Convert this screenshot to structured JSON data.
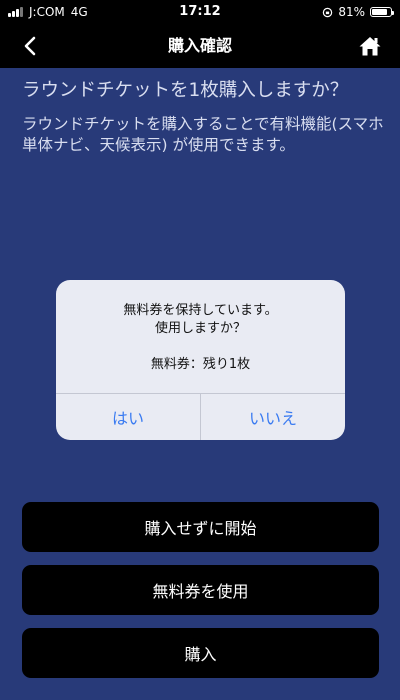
{
  "status_bar": {
    "carrier": "J:COM",
    "network": "4G",
    "time": "17:12",
    "battery": "81%",
    "battery_level": 0.81
  },
  "nav": {
    "title": "購入確認",
    "back_icon": "chevron-left-icon",
    "home_icon": "home-icon"
  },
  "content": {
    "question": "ラウンドチケットを1枚購入しますか？",
    "description": "ラウンドチケットを購入することで有料機能(スマホ単体ナビ、天候表示) が使用できます。"
  },
  "dialog": {
    "message_line1": "無料券を保持しています。",
    "message_line2": "使用しますか？",
    "remaining": "無料券：残り1枚",
    "yes_label": "はい",
    "no_label": "いいえ"
  },
  "buttons": {
    "start_without_purchase": "購入せずに開始",
    "use_free_ticket": "無料券を使用",
    "purchase": "購入"
  },
  "colors": {
    "background": "#283a79",
    "bar": "#000000",
    "dialog_bg": "#e9ebf3",
    "dialog_button": "#3a7bf1"
  }
}
